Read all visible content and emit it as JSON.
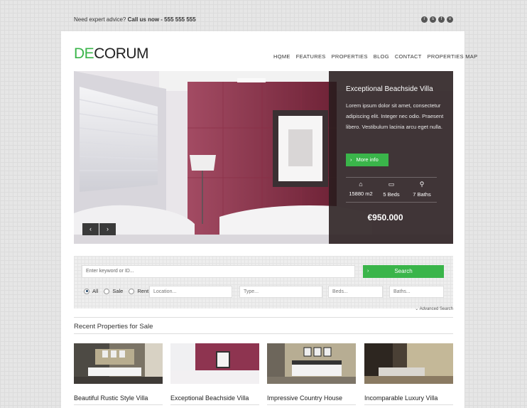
{
  "topbar": {
    "advice_label": "Need expert advice?",
    "call_label": "Call us now - 555 555 555",
    "social": [
      "rss-icon",
      "skype-icon",
      "facebook-icon",
      "vimeo-icon"
    ],
    "social_glyphs": [
      "r",
      "s",
      "f",
      "v"
    ]
  },
  "brand": {
    "logo_accent": "DE",
    "logo_rest": "CORUM",
    "accent_color": "#3ab54a"
  },
  "nav": {
    "items": [
      "HOME",
      "FEATURES",
      "PROPERTIES",
      "BLOG",
      "CONTACT",
      "PROPERTIES MAP"
    ],
    "active": "HOME"
  },
  "hero": {
    "title": "Exceptional Beachside Villa",
    "description": "Lorem ipsum dolor sit amet, consectetur adipiscing elit. Integer nec odio. Praesent libero. Vestibulum lacinia arcu eget nulla.",
    "button_label": "More info",
    "stats": [
      {
        "icon": "house-icon",
        "glyph": "⌂",
        "label": "15880 m2"
      },
      {
        "icon": "bed-icon",
        "glyph": "▭",
        "label": "5 Beds"
      },
      {
        "icon": "shower-icon",
        "glyph": "⚲",
        "label": "7 Baths"
      }
    ],
    "price": "€950.000",
    "prev_arrow": "‹",
    "next_arrow": "›"
  },
  "search": {
    "keyword_placeholder": "Enter keyword or ID...",
    "button_label": "Search",
    "radios": [
      {
        "label": "All",
        "checked": true
      },
      {
        "label": "Sale",
        "checked": false
      },
      {
        "label": "Rent",
        "checked": false
      }
    ],
    "location_placeholder": "Location...",
    "type_placeholder": "Type...",
    "beds_placeholder": "Beds...",
    "baths_placeholder": "Baths...",
    "advanced_label": "Advanced Search"
  },
  "recent": {
    "heading": "Recent Properties for Sale",
    "cards": [
      {
        "title": "Beautiful Rustic Style Villa"
      },
      {
        "title": "Exceptional Beachside Villa"
      },
      {
        "title": "Impressive Country House"
      },
      {
        "title": "Incomparable Luxury Villa"
      }
    ]
  }
}
